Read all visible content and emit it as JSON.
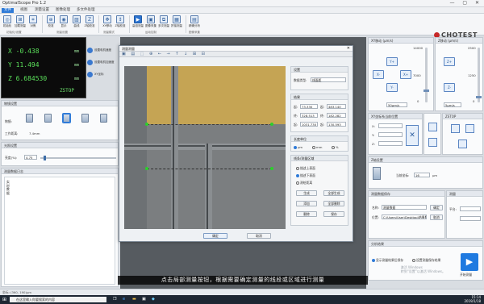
{
  "app": {
    "title": "OptimalScope Pro 1.2",
    "brand": "CHOTEST"
  },
  "menu": [
    "文件",
    "视图",
    "测量设置",
    "图像处理",
    "多文件处理"
  ],
  "ribbon": {
    "buttons": [
      "初始化",
      "加载测量",
      "对焦",
      "校准",
      "显示",
      "曲线",
      "Z轴校准",
      "XY移动",
      "Z轴校准",
      "高倍测量",
      "图像采集",
      "多次测量",
      "拼接测量",
      "精确分析"
    ],
    "groups": [
      "初始化/设置",
      "测量设置",
      "测量模式",
      "运动控制",
      "图像采集"
    ]
  },
  "coords": {
    "x": "X -0.438",
    "y": "Y 11.494",
    "z": "Z 6.684530",
    "unit": "mm",
    "status": "ZSTOP"
  },
  "side_buttons": [
    "设置电机速度",
    "设置电机加速度",
    "XY坐标"
  ],
  "lens_panel": {
    "title": "物镜设置",
    "label": "物镜:",
    "work_label": "工作距离:",
    "work_value": "7.4mm"
  },
  "light_panel": {
    "title": "光照设置",
    "label": "亮度(%):",
    "value": "4.75"
  },
  "log_panel": {
    "title": "测量数据日志",
    "text": "实时数据"
  },
  "dialog": {
    "title": "测量测量",
    "tools": "▣ ▤ ⬚ ⊕ ← → ↑ ↓ ⊞ ⊟",
    "settings": {
      "title": "设置",
      "label": "数据类型:",
      "value": "线面距"
    },
    "results": {
      "title": "结果",
      "labels": [
        "起:",
        "起:",
        "终:",
        "终:",
        "起:",
        "起:"
      ],
      "values": [
        "73.330",
        "483.140",
        "328.513",
        "182.282",
        "1031.730",
        "130.593"
      ]
    },
    "units": {
      "title": "长度单位",
      "options": [
        "μm",
        "mm",
        "%"
      ],
      "selected": 0
    },
    "lines": {
      "title": "线条/测量区域",
      "options": [
        "描述上表面",
        "描述下表面",
        "测绘距离"
      ],
      "selected": 1,
      "buttons": [
        "生成",
        "全部生成",
        "添加",
        "全部删除",
        "删除",
        "保存"
      ]
    },
    "ok": "确定",
    "cancel": "取消"
  },
  "xy_panel": {
    "title": "XY移动 (μm/s)",
    "scale": [
      "14000",
      "7000",
      "0"
    ],
    "speed": "50μm/s",
    "labels": [
      "Y+",
      "X-",
      "X+",
      "Y-"
    ]
  },
  "z_panel": {
    "title": "Z移动 (μm/s)",
    "scale": [
      "2500",
      "1250",
      "0"
    ],
    "speed": "5μm/s",
    "labels": [
      "Z+",
      "Z-"
    ]
  },
  "xyz_coords": {
    "title": "XY坐标系当前位置",
    "labels": [
      "X:",
      "Y:",
      "Z:"
    ]
  },
  "stop_panel": {
    "title": "ZSTOP"
  },
  "limit_panel": {
    "title": "Z轴设置",
    "label": "当前坐标:",
    "value": "16",
    "unit": "μm"
  },
  "data_panel": {
    "title": "测量数据保存",
    "name_label": "名称:",
    "name_value": "测量数据",
    "path_label": "位置:",
    "path_value": "C:\\Users\\User\\Desktop\\结果数据",
    "buttons": [
      "确定",
      "取消"
    ]
  },
  "analysis_panel": {
    "title": "分析结果",
    "options": [
      "显示测量结果后保存",
      "设置测量保存结果"
    ],
    "run": "开始测量"
  },
  "measure_panel": {
    "title": "测量",
    "label": "平台:"
  },
  "status": "坐标: (360, 190)μm",
  "subtitle": "点击局部测量按钮，根据需要确定测量的线段或区域进行测量",
  "watermark": [
    "激活 Windows",
    "转到“设置”以激活 Windows。"
  ],
  "taskbar": {
    "search": "在这里输入你要搜索的内容",
    "time": "15:14",
    "date": "2019/1/18"
  }
}
